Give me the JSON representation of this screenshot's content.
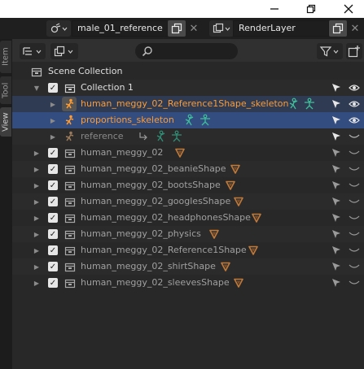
{
  "titlebar": {
    "minimize_icon": "minimize-icon",
    "maximize_icon": "maximize-icon",
    "close_icon": "close-icon"
  },
  "topbar": {
    "scene_name": "male_01_reference",
    "view_layer_name": "RenderLayer"
  },
  "left_tabs": [
    "Item",
    "Tool",
    "View"
  ],
  "outliner": {
    "search_placeholder": "",
    "scene_collection_label": "Scene Collection",
    "collection_label": "Collection 1",
    "rows": [
      {
        "label": "human_meggy_02_Reference1Shape_skeleton",
        "kind": "armature",
        "state": "selected"
      },
      {
        "label": "proportions_skeleton",
        "kind": "armature",
        "state": "active"
      },
      {
        "label": "reference",
        "kind": "armature",
        "state": "hidden"
      },
      {
        "label": "human_meggy_02",
        "kind": "mesh",
        "state": "normal"
      },
      {
        "label": "human_meggy_02_beanieShape",
        "kind": "mesh",
        "state": "normal"
      },
      {
        "label": "human_meggy_02_bootsShape",
        "kind": "mesh",
        "state": "normal"
      },
      {
        "label": "human_meggy_02_googlesShape",
        "kind": "mesh",
        "state": "normal"
      },
      {
        "label": "human_meggy_02_headphonesShape",
        "kind": "mesh",
        "state": "normal"
      },
      {
        "label": "human_meggy_02_physics",
        "kind": "mesh",
        "state": "normal"
      },
      {
        "label": "human_meggy_02_Reference1Shape",
        "kind": "mesh",
        "state": "normal"
      },
      {
        "label": "human_meggy_02_shirtShape",
        "kind": "mesh",
        "state": "normal"
      },
      {
        "label": "human_meggy_02_sleevesShape",
        "kind": "mesh",
        "state": "normal"
      }
    ]
  },
  "colors": {
    "accent_orange": "#ff9b30",
    "active_row": "#334d80",
    "bone_green": "#3fbf9a",
    "mesh_triangle": "#c07a3a"
  }
}
